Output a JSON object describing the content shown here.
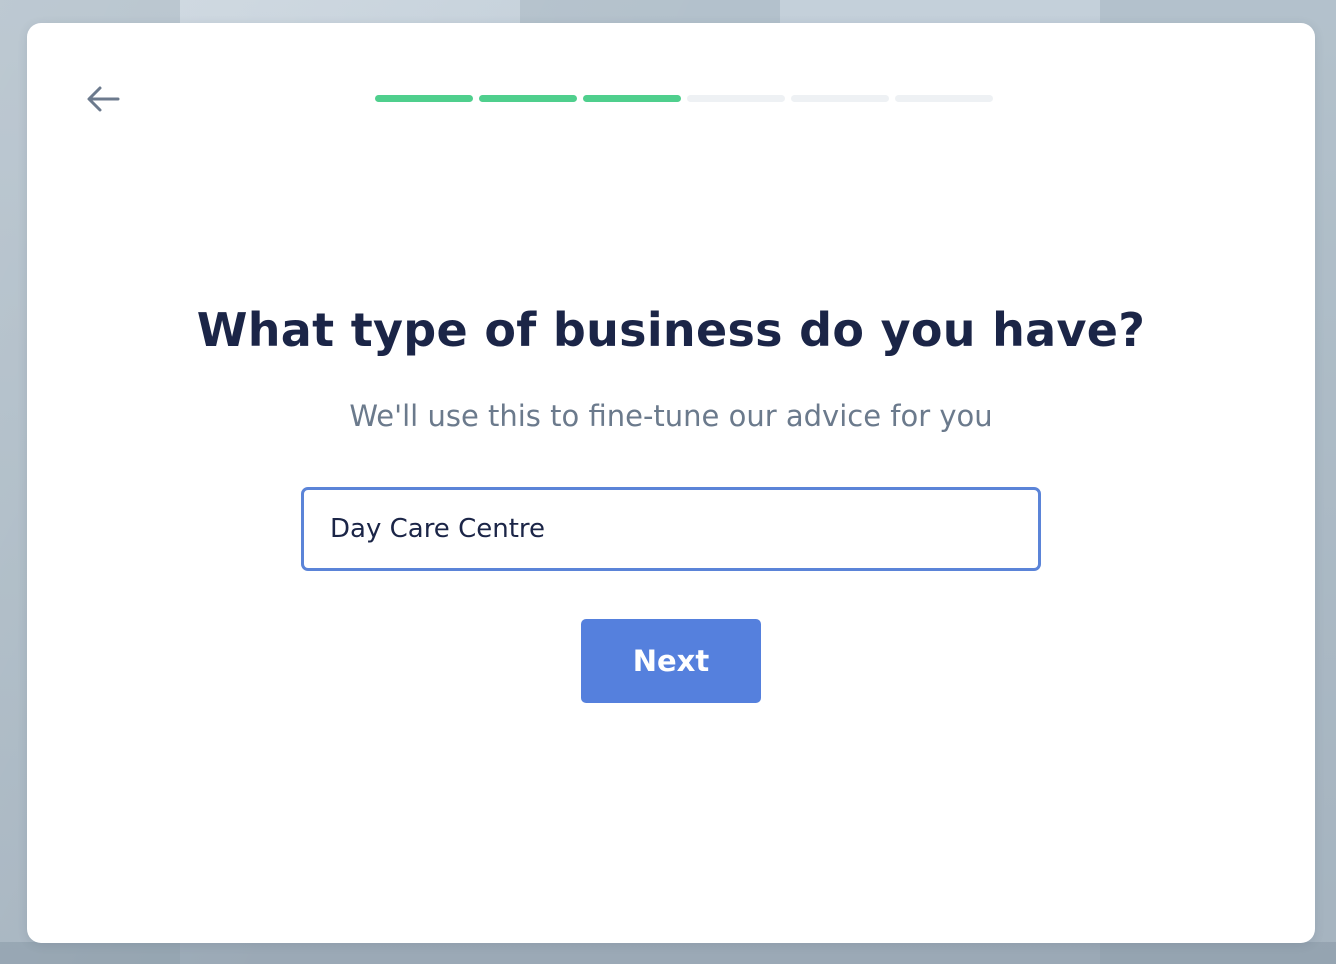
{
  "onboarding": {
    "back_icon": "arrow-left-icon",
    "progress": {
      "current_step": 3,
      "total_steps": 6,
      "completed_color": "#4fcf8d",
      "pending_color": "#eef1f4"
    },
    "question": {
      "title": "What type of business do you have?",
      "subtitle": "We'll use this to fine-tune our advice for you"
    },
    "business_type_input": {
      "value": "Day Care Centre",
      "focused_border_color": "#5b84d8"
    },
    "next_button": {
      "label": "Next",
      "color": "#5580dd"
    }
  }
}
